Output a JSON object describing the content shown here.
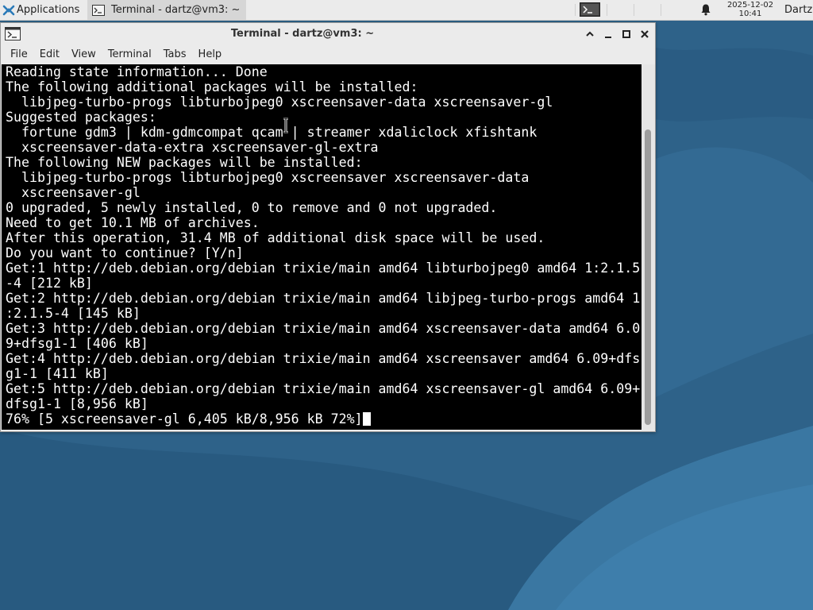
{
  "panel": {
    "applications_label": "Applications",
    "task_label": "Terminal - dartz@vm3: ~",
    "clock_date": "2025-12-02",
    "clock_time": "10:41",
    "user": "Dartz"
  },
  "window": {
    "title": "Terminal - dartz@vm3: ~",
    "menu": [
      "File",
      "Edit",
      "View",
      "Terminal",
      "Tabs",
      "Help"
    ],
    "terminal_lines": [
      "Reading state information... Done",
      "The following additional packages will be installed:",
      "  libjpeg-turbo-progs libturbojpeg0 xscreensaver-data xscreensaver-gl",
      "Suggested packages:",
      "  fortune gdm3 | kdm-gdmcompat qcam | streamer xdaliclock xfishtank",
      "  xscreensaver-data-extra xscreensaver-gl-extra",
      "The following NEW packages will be installed:",
      "  libjpeg-turbo-progs libturbojpeg0 xscreensaver xscreensaver-data",
      "  xscreensaver-gl",
      "0 upgraded, 5 newly installed, 0 to remove and 0 not upgraded.",
      "Need to get 10.1 MB of archives.",
      "After this operation, 31.4 MB of additional disk space will be used.",
      "Do you want to continue? [Y/n]",
      "Get:1 http://deb.debian.org/debian trixie/main amd64 libturbojpeg0 amd64 1:2.1.5",
      "-4 [212 kB]",
      "Get:2 http://deb.debian.org/debian trixie/main amd64 libjpeg-turbo-progs amd64 1",
      ":2.1.5-4 [145 kB]",
      "Get:3 http://deb.debian.org/debian trixie/main amd64 xscreensaver-data amd64 6.0",
      "9+dfsg1-1 [406 kB]",
      "Get:4 http://deb.debian.org/debian trixie/main amd64 xscreensaver amd64 6.09+dfs",
      "g1-1 [411 kB]",
      "Get:5 http://deb.debian.org/debian trixie/main amd64 xscreensaver-gl amd64 6.09+",
      "dfsg1-1 [8,956 kB]"
    ],
    "progress_line": "76% [5 xscreensaver-gl 6,405 kB/8,956 kB 72%]"
  },
  "colors": {
    "terminal_bg": "#000000",
    "terminal_fg": "#ffffff",
    "panel_bg": "#ebebeb",
    "desktop_bg": "#2c5f86"
  },
  "icons": {
    "panel": [
      "applications-icon",
      "terminal-icon",
      "terminal-launcher-icon",
      "bell-icon"
    ],
    "window": [
      "terminal-icon",
      "maximize-up-icon",
      "minimize-icon",
      "maximize-icon",
      "close-icon"
    ]
  }
}
